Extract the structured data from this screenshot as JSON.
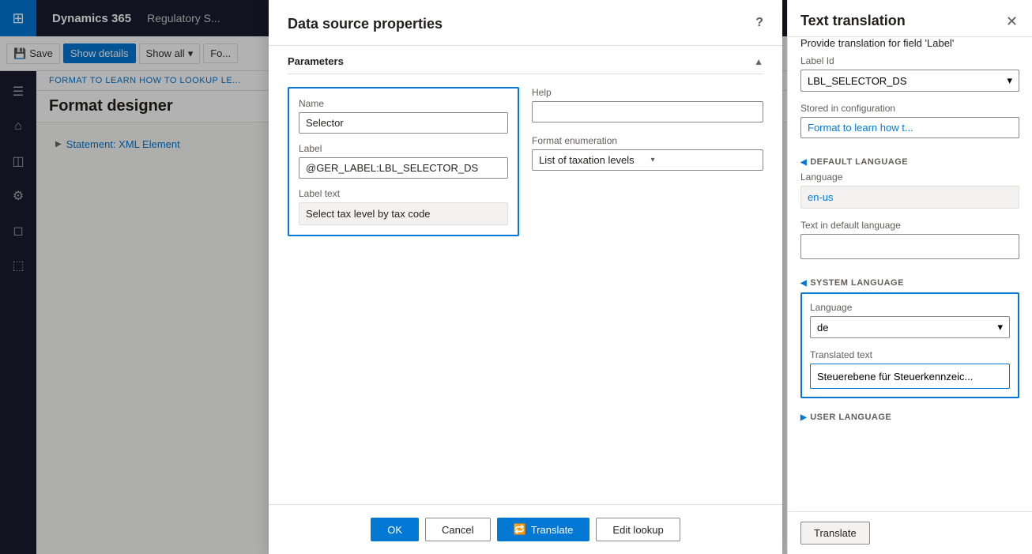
{
  "app": {
    "waffle_icon": "⊞",
    "title": "Dynamics 365",
    "subtitle": "Regulatory S..."
  },
  "toolbar": {
    "save_label": "Save",
    "show_details_label": "Show details",
    "show_all_label": "Show all",
    "show_all_dropdown": "▾",
    "format_label": "Fo..."
  },
  "sidebar": {
    "icons": [
      "☰",
      "⌂",
      "◫",
      "☰",
      "◻",
      "⬚"
    ]
  },
  "breadcrumb": "FORMAT TO LEARN HOW TO LOOKUP LE...",
  "page_title": "Format designer",
  "tree": {
    "item_label": "Statement: XML Element"
  },
  "dialog": {
    "title": "Data source properties",
    "help_char": "?",
    "params_section": "Parameters",
    "name_label": "Name",
    "name_value": "Selector",
    "label_label": "Label",
    "label_value": "@GER_LABEL:LBL_SELECTOR_DS",
    "label_text_label": "Label text",
    "label_text_value": "Select tax level by tax code",
    "help_label": "Help",
    "help_value": "",
    "format_enum_label": "Format enumeration",
    "format_enum_value": "List of taxation levels",
    "format_enum_arrow": "▾",
    "btn_ok": "OK",
    "btn_cancel": "Cancel",
    "btn_translate": "Translate",
    "btn_translate_icon": "🔁",
    "btn_edit_lookup": "Edit lookup"
  },
  "text_translation": {
    "title": "Text translation",
    "close_icon": "✕",
    "subtitle": "Provide translation for field 'Label'",
    "label_id_label": "Label Id",
    "label_id_value": "LBL_SELECTOR_DS",
    "label_id_arrow": "▾",
    "stored_label": "Stored in configuration",
    "stored_value": "Format to learn how t...",
    "default_lang_header": "DEFAULT LANGUAGE",
    "language_label": "Language",
    "language_value": "en-us",
    "text_default_label": "Text in default language",
    "text_default_value": "",
    "system_lang_header": "SYSTEM LANGUAGE",
    "sys_language_label": "Language",
    "sys_language_value": "de",
    "sys_language_arrow": "▾",
    "translated_text_label": "Translated text",
    "translated_text_value": "Steuerebene für Steuerkennzeic...",
    "user_lang_header": "USER LANGUAGE",
    "user_lang_arrow": "▶",
    "footer_translate": "Translate"
  }
}
